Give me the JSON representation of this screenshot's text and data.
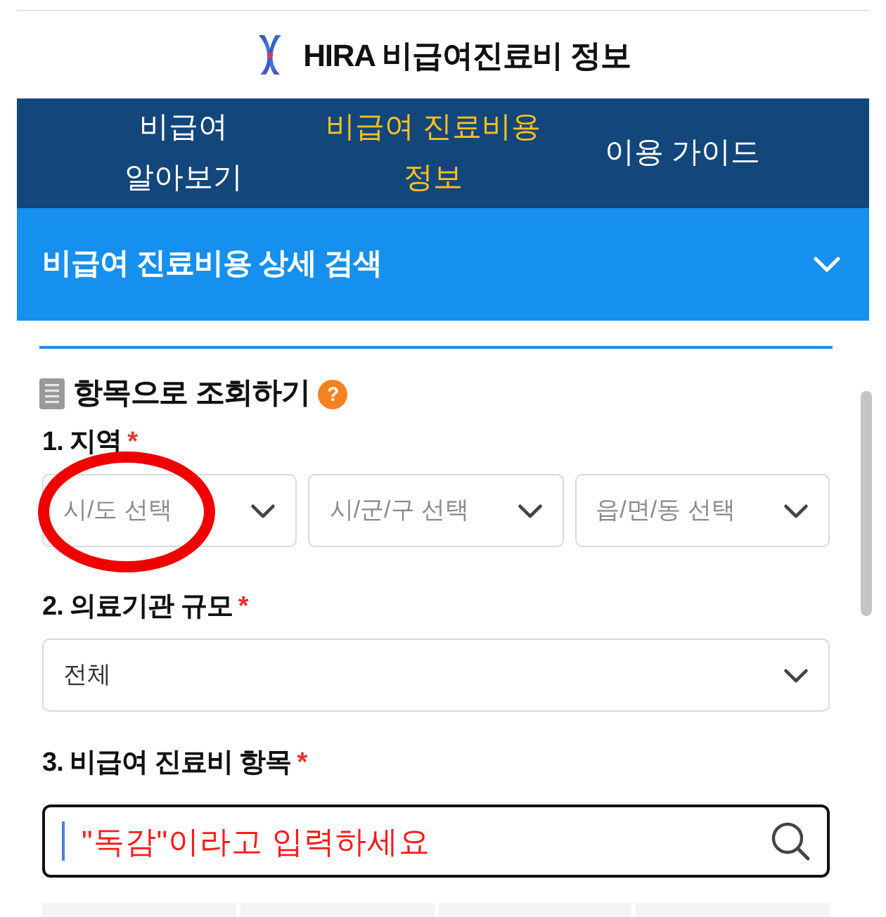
{
  "header": {
    "title": "HIRA 비급여진료비 정보"
  },
  "nav": {
    "tabs": [
      {
        "label": "비급여\n알아보기",
        "selected": false
      },
      {
        "label": "비급여 진료비용\n정보",
        "selected": true
      },
      {
        "label": "이용 가이드",
        "selected": false
      }
    ]
  },
  "search_panel": {
    "title": "비급여 진료비용 상세 검색"
  },
  "query": {
    "heading": "항목으로 조회하기",
    "help": "?",
    "region": {
      "label": "1. 지역",
      "mark": "*",
      "selects": [
        {
          "placeholder": "시/도 선택"
        },
        {
          "placeholder": "시/군/구 선택"
        },
        {
          "placeholder": "읍/면/동 선택"
        }
      ]
    },
    "scale": {
      "label": "2. 의료기관 규모",
      "mark": "*",
      "select": {
        "value": "전체"
      }
    },
    "item": {
      "label": "3. 비급여 진료비 항목",
      "mark": "*",
      "annotation_text": "\"독감\"이라고 입력하세요"
    }
  }
}
